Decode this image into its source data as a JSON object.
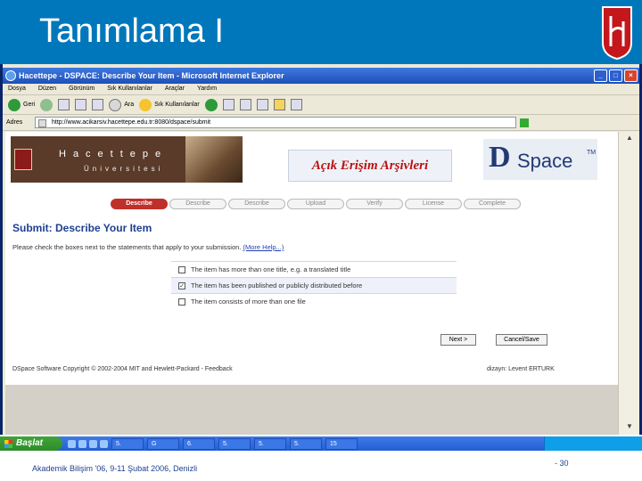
{
  "slide": {
    "title": "Tanımlama I",
    "footer": "Akademik Bilişim '06, 9-11 Şubat 2006, Denizli",
    "page_number": "- 30"
  },
  "browser": {
    "title": "Hacettepe - DSPACE: Describe Your Item - Microsoft Internet Explorer",
    "menu": [
      "Dosya",
      "Düzen",
      "Görünüm",
      "Sık Kullanılanlar",
      "Araçlar",
      "Yardım"
    ],
    "toolbar": {
      "back": "Geri",
      "search": "Ara",
      "favorites": "Sık Kullanılanlar"
    },
    "address_label": "Adres",
    "url": "http://www.acikarsiv.hacettepe.edu.tr:8080/dspace/submit",
    "buttons": {
      "minimize": "_",
      "maximize": "□",
      "close": "×"
    }
  },
  "page": {
    "banner_name": "Hacettepe",
    "banner_sub": "Üniversitesi",
    "archive_title": "Açık Erişim Arşivleri",
    "dspace_d": "D",
    "dspace_space": "Space",
    "dspace_tm": "TM",
    "steps": [
      "Describe",
      "Describe",
      "Describe",
      "Upload",
      "Verify",
      "License",
      "Complete"
    ],
    "heading": "Submit: Describe Your Item",
    "instruction": "Please check the boxes next to the statements that apply to your submission.",
    "more_help": "(More Help...)",
    "options": [
      {
        "label": "The item has more than one title, e.g. a translated title",
        "checked": false
      },
      {
        "label": "The item has been published or publicly distributed before",
        "checked": true
      },
      {
        "label": "The item consists of more than one file",
        "checked": false
      }
    ],
    "next_button": "Next >",
    "cancel_button": "Cancel/Save",
    "copyright": "DSpace Software Copyright © 2002-2004 MIT and Hewlett-Packard - Feedback",
    "designer": "dizayn: Levent ERTURK"
  },
  "taskbar": {
    "start": "Başlat",
    "tasks": [
      "5.",
      "G",
      "6.",
      "5.",
      "5.",
      "5.",
      "15"
    ]
  }
}
